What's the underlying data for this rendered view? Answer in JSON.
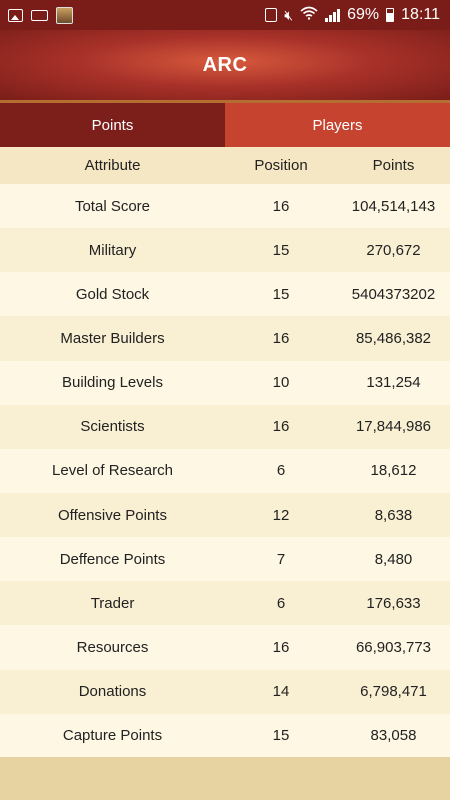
{
  "status_bar": {
    "battery_pct": "69%",
    "time": "18:11"
  },
  "header": {
    "title": "ARC"
  },
  "tabs": [
    {
      "label": "Points",
      "active": true
    },
    {
      "label": "Players",
      "active": false
    }
  ],
  "table": {
    "columns": [
      "Attribute",
      "Position",
      "Points"
    ],
    "rows": [
      {
        "attribute": "Total Score",
        "position": "16",
        "points": "104,514,143"
      },
      {
        "attribute": "Military",
        "position": "15",
        "points": "270,672"
      },
      {
        "attribute": "Gold Stock",
        "position": "15",
        "points": "5404373202"
      },
      {
        "attribute": "Master Builders",
        "position": "16",
        "points": "85,486,382"
      },
      {
        "attribute": "Building Levels",
        "position": "10",
        "points": "131,254"
      },
      {
        "attribute": "Scientists",
        "position": "16",
        "points": "17,844,986"
      },
      {
        "attribute": "Level of Research",
        "position": "6",
        "points": "18,612"
      },
      {
        "attribute": "Offensive Points",
        "position": "12",
        "points": "8,638"
      },
      {
        "attribute": "Deffence Points",
        "position": "7",
        "points": "8,480"
      },
      {
        "attribute": "Trader",
        "position": "6",
        "points": "176,633"
      },
      {
        "attribute": "Resources",
        "position": "16",
        "points": "66,903,773"
      },
      {
        "attribute": "Donations",
        "position": "14",
        "points": "6,798,471"
      },
      {
        "attribute": "Capture Points",
        "position": "15",
        "points": "83,058"
      }
    ]
  },
  "colors": {
    "header_dark": "#7a1d18",
    "header_mid": "#a9322a",
    "tab_active": "#7c1f1a",
    "tab_inactive": "#c5432f",
    "background": "#f6e7c4"
  }
}
